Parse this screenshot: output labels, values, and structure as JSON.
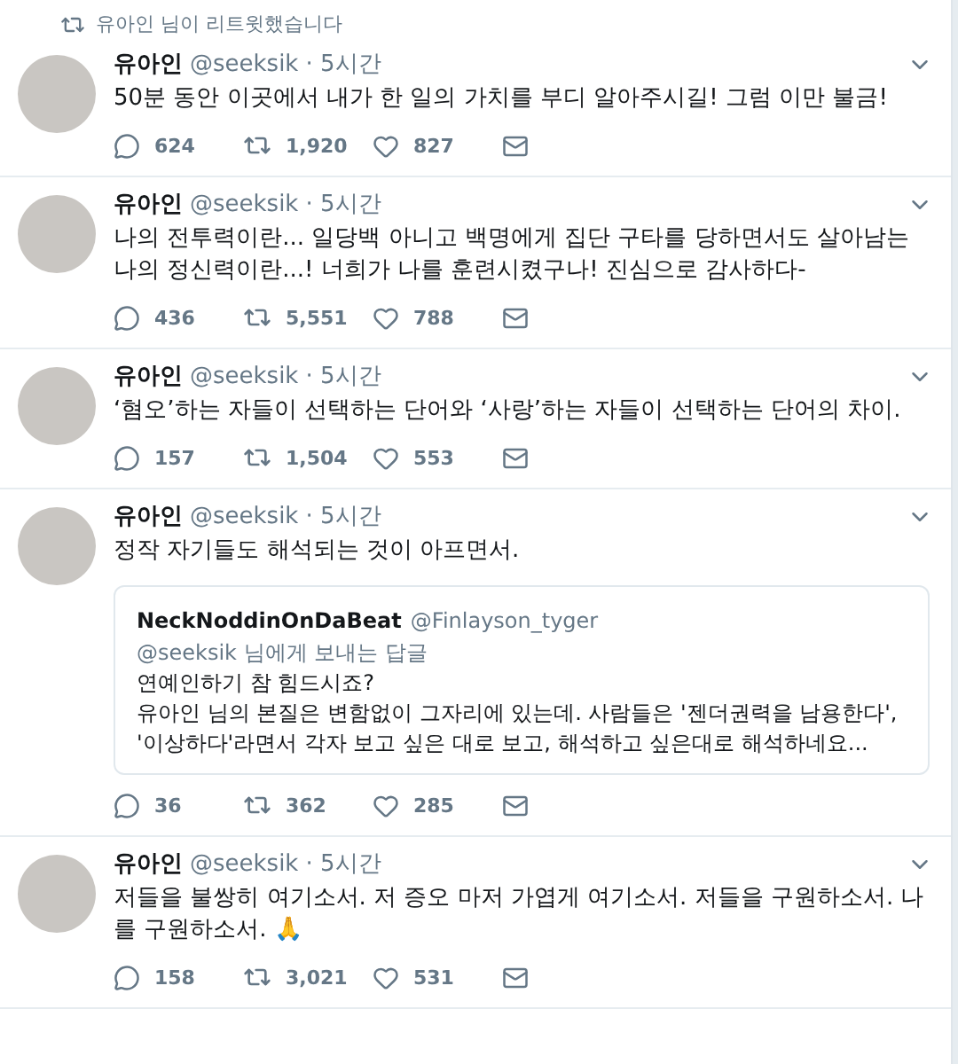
{
  "retweet_header": {
    "text": "유아인 님이 리트윗했습니다"
  },
  "tweets": [
    {
      "name": "유아인",
      "handle": "@seeksik",
      "time": "· 5시간",
      "text": "50분 동안 이곳에서 내가 한 일의 가치를 부디 알아주시길! 그럼 이만 불금!",
      "replies": "624",
      "retweets": "1,920",
      "likes": "827"
    },
    {
      "name": "유아인",
      "handle": "@seeksik",
      "time": "· 5시간",
      "text": "나의 전투력이란... 일당백 아니고 백명에게 집단 구타를 당하면서도 살아남는 나의 정신력이란...! 너희가 나를 훈련시켰구나! 진심으로 감사하다-",
      "replies": "436",
      "retweets": "5,551",
      "likes": "788"
    },
    {
      "name": "유아인",
      "handle": "@seeksik",
      "time": "· 5시간",
      "text": "‘혐오’하는 자들이 선택하는 단어와 ‘사랑’하는 자들이 선택하는 단어의 차이.",
      "replies": "157",
      "retweets": "1,504",
      "likes": "553"
    },
    {
      "name": "유아인",
      "handle": "@seeksik",
      "time": "· 5시간",
      "text": "정작 자기들도 해석되는 것이 아프면서.",
      "quote": {
        "name": "NeckNoddinOnDaBeat",
        "handle": "@Finlayson_tyger",
        "reply_to": "@seeksik 님에게 보내는 답글",
        "lines": [
          "연예인하기 참 힘드시죠?",
          "유아인 님의 본질은 변함없이 그자리에 있는데. 사람들은 '젠더권력을 남용한다', '이상하다'라면서 각자 보고 싶은 대로 보고, 해석하고 싶은대로 해석하네요..."
        ]
      },
      "replies": "36",
      "retweets": "362",
      "likes": "285"
    },
    {
      "name": "유아인",
      "handle": "@seeksik",
      "time": "· 5시간",
      "text": "저들을 불쌍히 여기소서. 저 증오 마저 가엽게 여기소서. 저들을 구원하소서. 나를 구원하소서. 🙏",
      "replies": "158",
      "retweets": "3,021",
      "likes": "531"
    }
  ]
}
